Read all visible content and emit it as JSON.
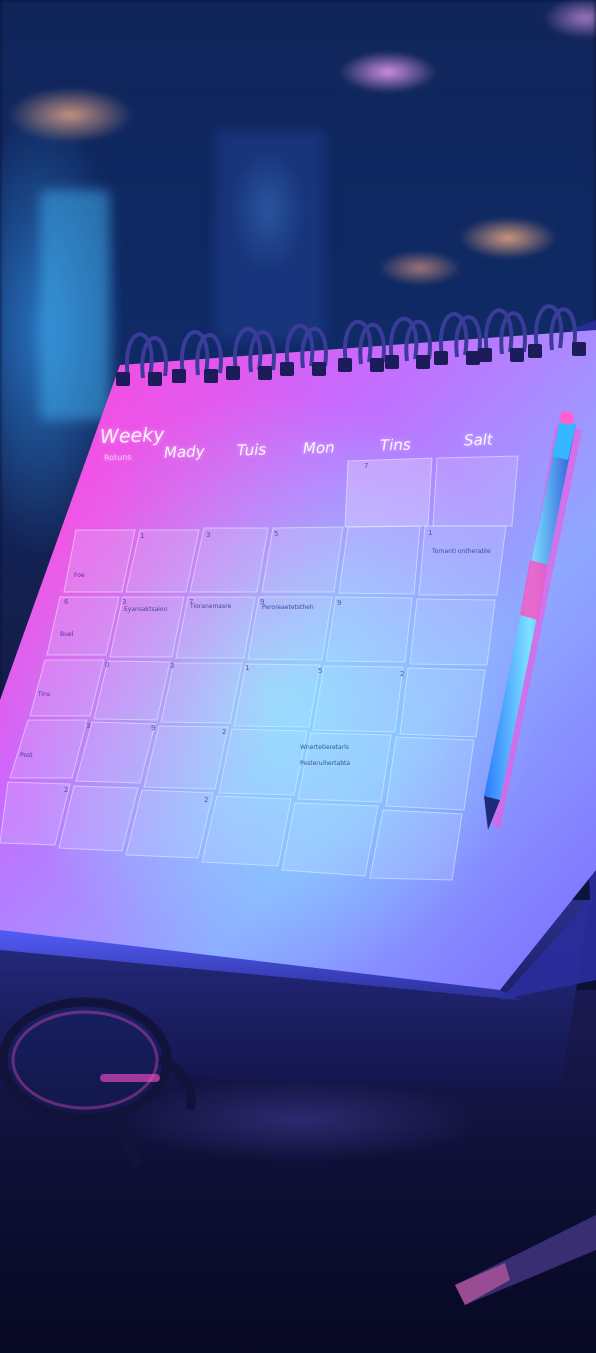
{
  "calendar": {
    "title": "Weeky",
    "subtitle": "Rotuns",
    "day_headers": [
      "Mady",
      "Tuis",
      "Mon",
      "Tins",
      "Salt"
    ],
    "row_labels": [
      "Foe",
      "Buel",
      "Tins",
      "Post"
    ],
    "cell_numbers": [
      "7",
      "1",
      "3",
      "5",
      "1",
      "6",
      "3",
      "7",
      "9",
      "9",
      "0",
      "3",
      "1",
      "5",
      "2",
      "3",
      "9",
      "2",
      "2",
      "2"
    ],
    "notes": [
      "Tornanti ontherable",
      "Eyansaktsaion",
      "Tioranemasre",
      "Peroreaetetstheh",
      "Wnertetieretarls",
      "Pesteruihertabta"
    ]
  },
  "colors": {
    "magenta": "#ff3fd8",
    "violet": "#9b6cff",
    "cyan": "#4ec6ff",
    "desk": "#0d0f34"
  }
}
